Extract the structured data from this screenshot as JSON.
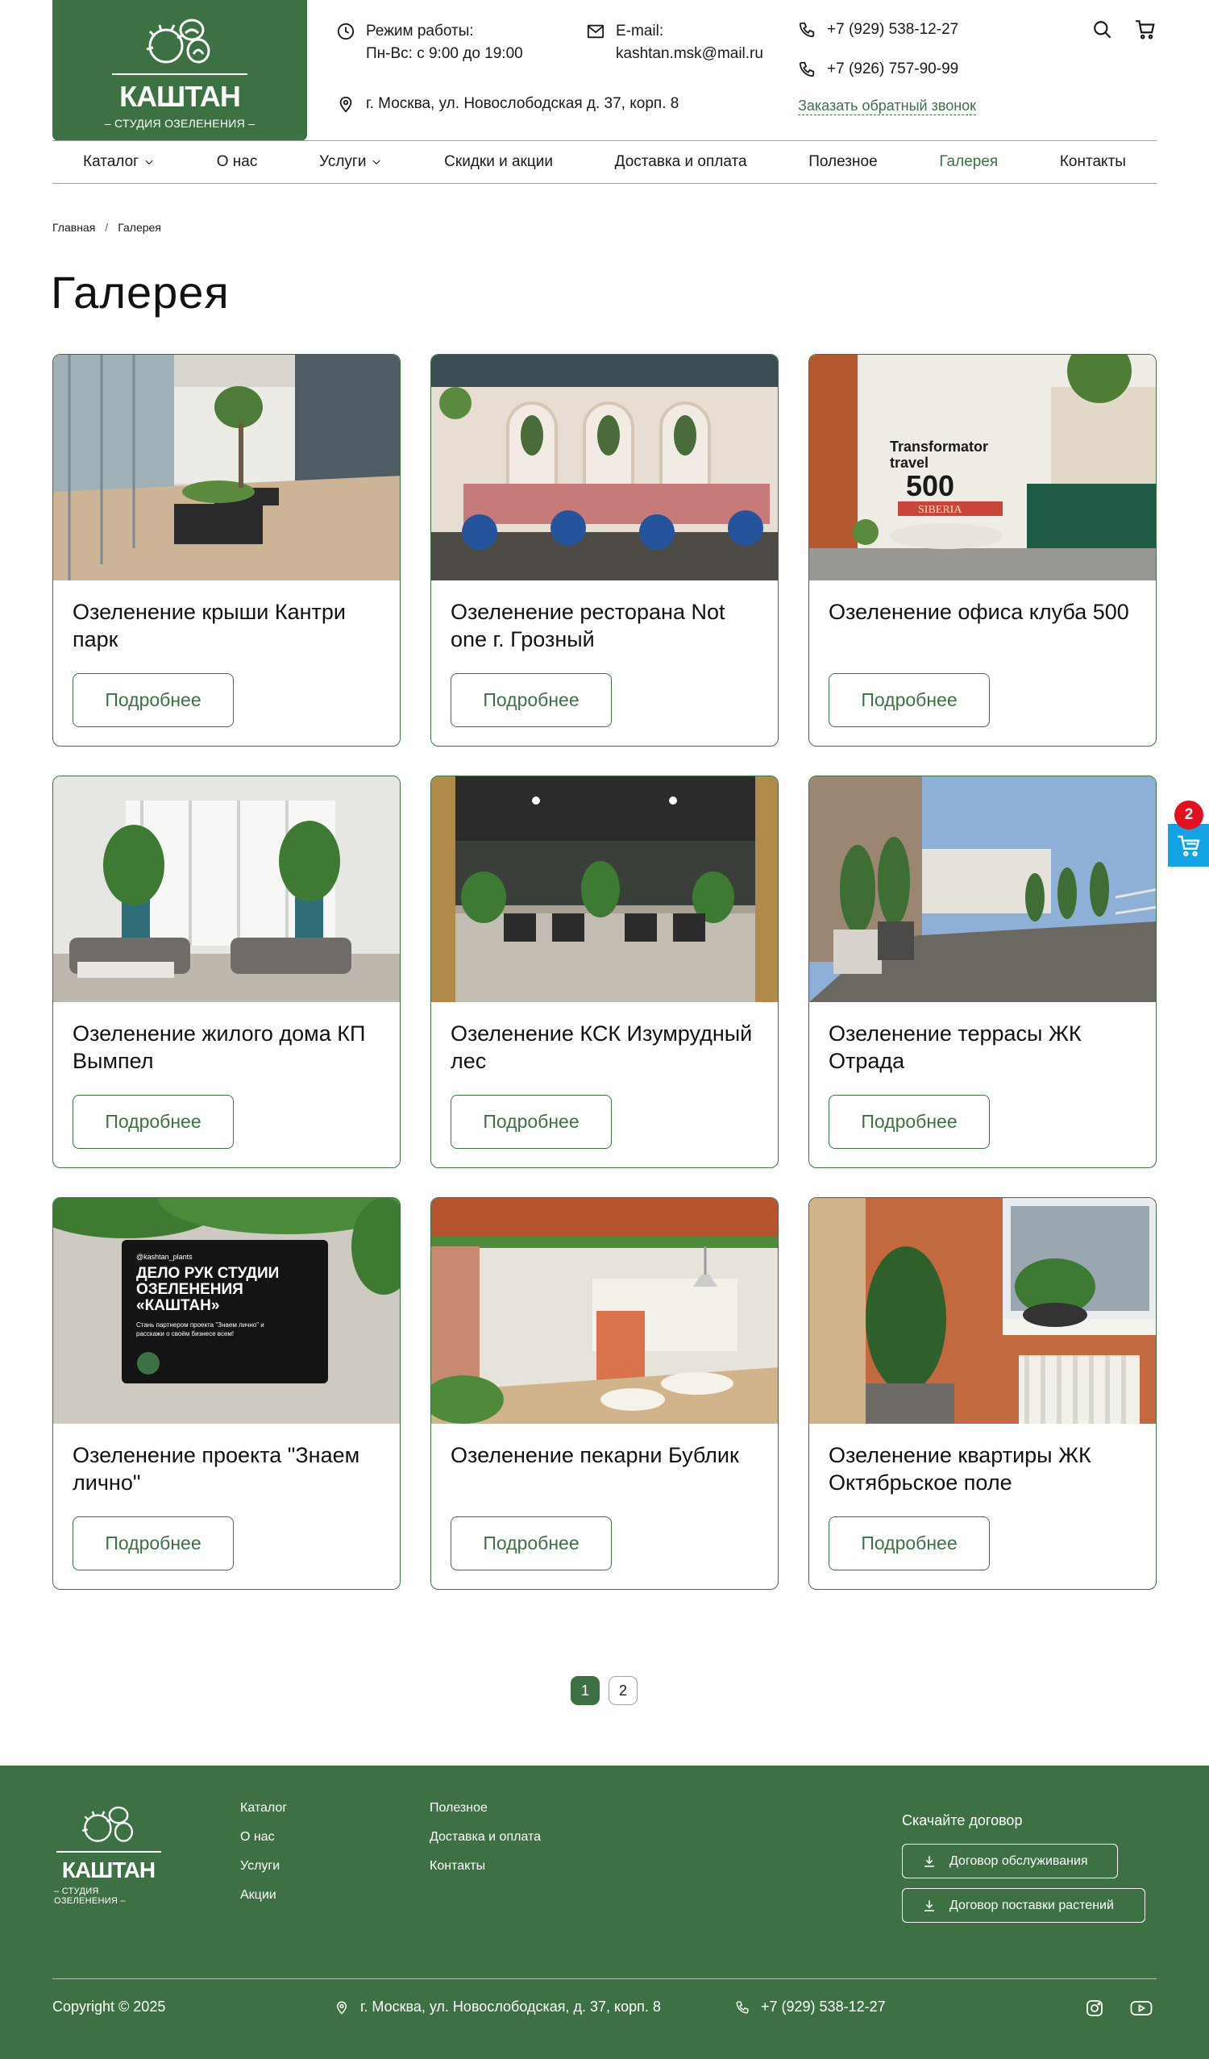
{
  "brand": {
    "name": "КАШТАН",
    "subtitle": "– СТУДИЯ ОЗЕЛЕНЕНИЯ –",
    "color": "#3d7144"
  },
  "header": {
    "hours_label": "Режим работы:",
    "hours_value": "Пн-Вс: с 9:00 до 19:00",
    "email_label": "E-mail:",
    "email_value": "kashtan.msk@mail.ru",
    "address": "г. Москва, ул. Новослободская д. 37, корп. 8",
    "phone1": "+7 (929) 538-12-27",
    "phone2": "+7 (926) 757-90-99",
    "callback": "Заказать обратный звонок"
  },
  "nav": [
    {
      "label": "Каталог",
      "dropdown": true
    },
    {
      "label": "О нас",
      "dropdown": false
    },
    {
      "label": "Услуги",
      "dropdown": true
    },
    {
      "label": "Скидки и акции",
      "dropdown": false
    },
    {
      "label": "Доставка и оплата",
      "dropdown": false
    },
    {
      "label": "Полезное",
      "dropdown": false
    },
    {
      "label": "Галерея",
      "dropdown": false,
      "active": true
    },
    {
      "label": "Контакты",
      "dropdown": false
    }
  ],
  "breadcrumb": {
    "home": "Главная",
    "sep": "/",
    "current": "Галерея"
  },
  "page_title": "Галерея",
  "cards": [
    {
      "title": "Озеленение крыши Кантри парк",
      "button": "Подробнее",
      "image": "rooftop-terrace-photo"
    },
    {
      "title": "Озеленение ресторана Not one г. Грозный",
      "button": "Подробнее",
      "image": "restaurant-interior-photo"
    },
    {
      "title": "Озеленение офиса клуба 500",
      "button": "Подробнее",
      "image": "office-club-photo"
    },
    {
      "title": "Озеленение жилого дома КП Вымпел",
      "button": "Подробнее",
      "image": "residential-lounge-photo"
    },
    {
      "title": "Озеленение КСК Изумрудный лес",
      "button": "Подробнее",
      "image": "sports-hall-photo"
    },
    {
      "title": "Озеленение террасы ЖК Отрада",
      "button": "Подробнее",
      "image": "terrace-photo"
    },
    {
      "title": "Озеленение проекта \"Знаем лично\"",
      "button": "Подробнее",
      "image": "sign-photo"
    },
    {
      "title": "Озеленение пекарни Бублик",
      "button": "Подробнее",
      "image": "bakery-photo"
    },
    {
      "title": "Озеленение квартиры ЖК Октябрьское поле",
      "button": "Подробнее",
      "image": "apartment-photo"
    }
  ],
  "sign_text": {
    "handle": "@kashtan_plants",
    "headline": "ДЕЛО РУК СТУДИИ ОЗЕЛЕНЕНИЯ «КАШТАН»",
    "body": "Стань партнером проекта \"Знаем лично\" и расскажи о своём бизнесе всем!"
  },
  "office_sign": {
    "line1": "Transformator",
    "line2": "travel",
    "number": "500",
    "brand": "SIBERIA"
  },
  "pagination": {
    "pages": [
      "1",
      "2"
    ],
    "current": "1"
  },
  "cart_badge": "2",
  "footer": {
    "col1": [
      "Каталог",
      "О нас",
      "Услуги",
      "Акции"
    ],
    "col2": [
      "Полезное",
      "Доставка и оплата",
      "Контакты"
    ],
    "download_title": "Скачайте договор",
    "download1": "Договор обслуживания",
    "download2": "Договор поставки растений",
    "copyright": "Copyright © 2025",
    "address": "г. Москва, ул. Новослободская, д. 37, корп. 8",
    "phone": "+7 (929) 538-12-27"
  },
  "colors": {
    "accent": "#3d7144",
    "cart": "#11a3e4",
    "badge": "#e3101f"
  }
}
